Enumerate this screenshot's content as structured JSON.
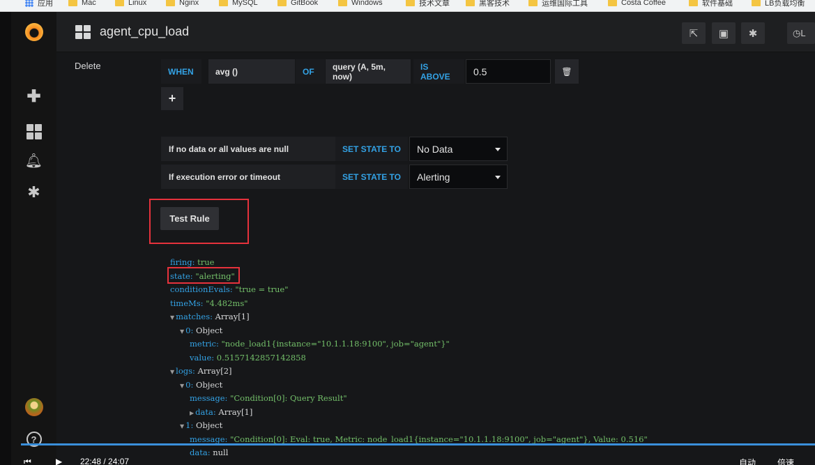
{
  "bookmarks": [
    "应用",
    "Mac",
    "Linux",
    "Nginx",
    "MySQL",
    "GitBook",
    "Windows",
    "技术文章",
    "黑客技术",
    "运维国际工具",
    "Costa Coffee",
    "软件基础",
    "LB负载均衡"
  ],
  "navbar": {
    "title": "agent_cpu_load",
    "clock_label": "L"
  },
  "sidebar": {
    "icons": [
      "grafana-logo-icon",
      "plus-icon",
      "dashboards-icon",
      "bell-icon",
      "gear-icon",
      "avatar",
      "help-icon"
    ],
    "help_glyph": "?"
  },
  "condition": {
    "delete_label": "Delete",
    "when": "WHEN",
    "reducer": "avg ()",
    "of": "OF",
    "query": "query (A, 5m, now)",
    "evaluator": "IS ABOVE",
    "threshold": "0.5",
    "add_glyph": "+"
  },
  "no_data_row": {
    "label": "If no data or all values are null",
    "action": "SET STATE TO",
    "value": "No Data"
  },
  "error_row": {
    "label": "If execution error or timeout",
    "action": "SET STATE TO",
    "value": "Alerting"
  },
  "test_rule_label": "Test Rule",
  "result": {
    "firing_key": "firing:",
    "firing_val": "true",
    "state_key": "state:",
    "state_val": "\"alerting\"",
    "evals_key": "conditionEvals:",
    "evals_val": "\"true = true\"",
    "time_key": "timeMs:",
    "time_val": "\"4.482ms\"",
    "matches_key": "matches:",
    "matches_val": "Array[1]",
    "m0_key": "0:",
    "m0_val": "Object",
    "metric_key": "metric:",
    "metric_val": "\"node_load1{instance=\"10.1.1.18:9100\", job=\"agent\"}\"",
    "value_key": "value:",
    "value_val": "0.5157142857142858",
    "logs_key": "logs:",
    "logs_val": "Array[2]",
    "l0_key": "0:",
    "l0_val": "Object",
    "l0_msg_key": "message:",
    "l0_msg_val": "\"Condition[0]: Query Result\"",
    "l0_data_key": "data:",
    "l0_data_val": "Array[1]",
    "l1_key": "1:",
    "l1_val": "Object",
    "l1_msg_key": "message:",
    "l1_msg_val": "\"Condition[0]: Eval: true, Metric: node_load1{instance=\"10.1.1.18:9100\", job=\"agent\"}, Value: 0.516\"",
    "l1_data_key": "data:",
    "l1_data_val": "null"
  },
  "video": {
    "time": "22:48 / 24:07",
    "auto": "自动",
    "speed": "倍速"
  },
  "colors": {
    "keyword_blue": "#33a2e5",
    "string_green": "#73bf69",
    "highlight_red": "#e6323c"
  }
}
